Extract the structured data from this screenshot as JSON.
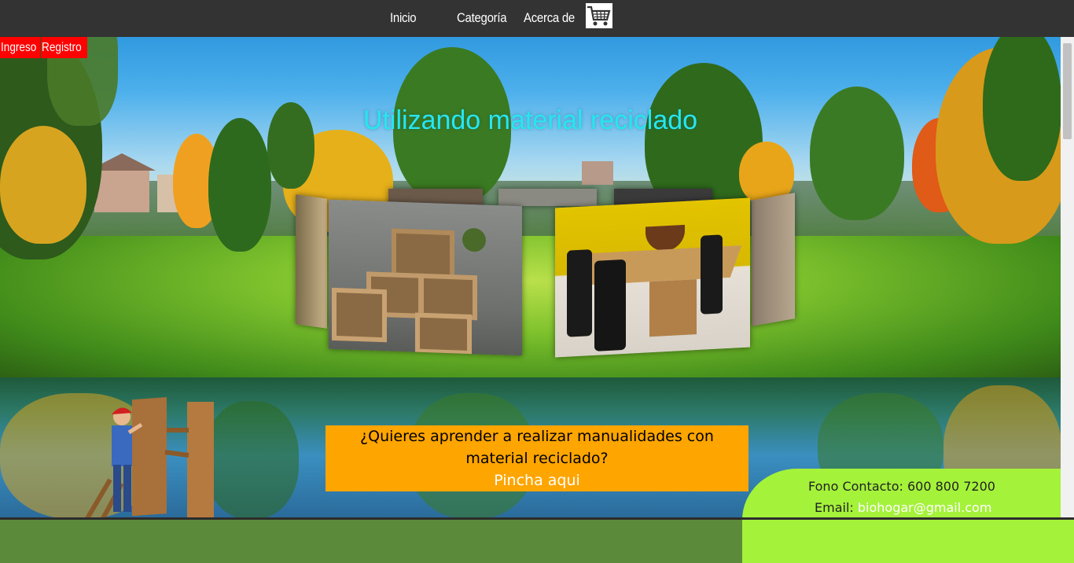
{
  "nav": {
    "items": [
      "Inicio",
      "Categoría",
      "Acerca de"
    ],
    "cart_icon": "shopping-cart-icon"
  },
  "auth": {
    "login": "Ingreso",
    "register": "Registro"
  },
  "hero": {
    "subtitle": "Utilizando material reciclado"
  },
  "carousel": {
    "images": [
      "wooden-crate-shelves",
      "pallet-dining-table"
    ]
  },
  "cta": {
    "question": "¿Quieres aprender a realizar manualidades con material reciclado?",
    "link": "Pincha aqui"
  },
  "contact": {
    "phone_label": "Fono Contacto: 600 800 7200",
    "email_label": "Email:",
    "email": "biohogar@gmail.com"
  },
  "colors": {
    "navbar": "#333333",
    "auth_bg": "#ff0000",
    "subtitle": "#27e6f0",
    "cta_bg": "#ffa500",
    "contact_bg": "#a4f23a"
  }
}
